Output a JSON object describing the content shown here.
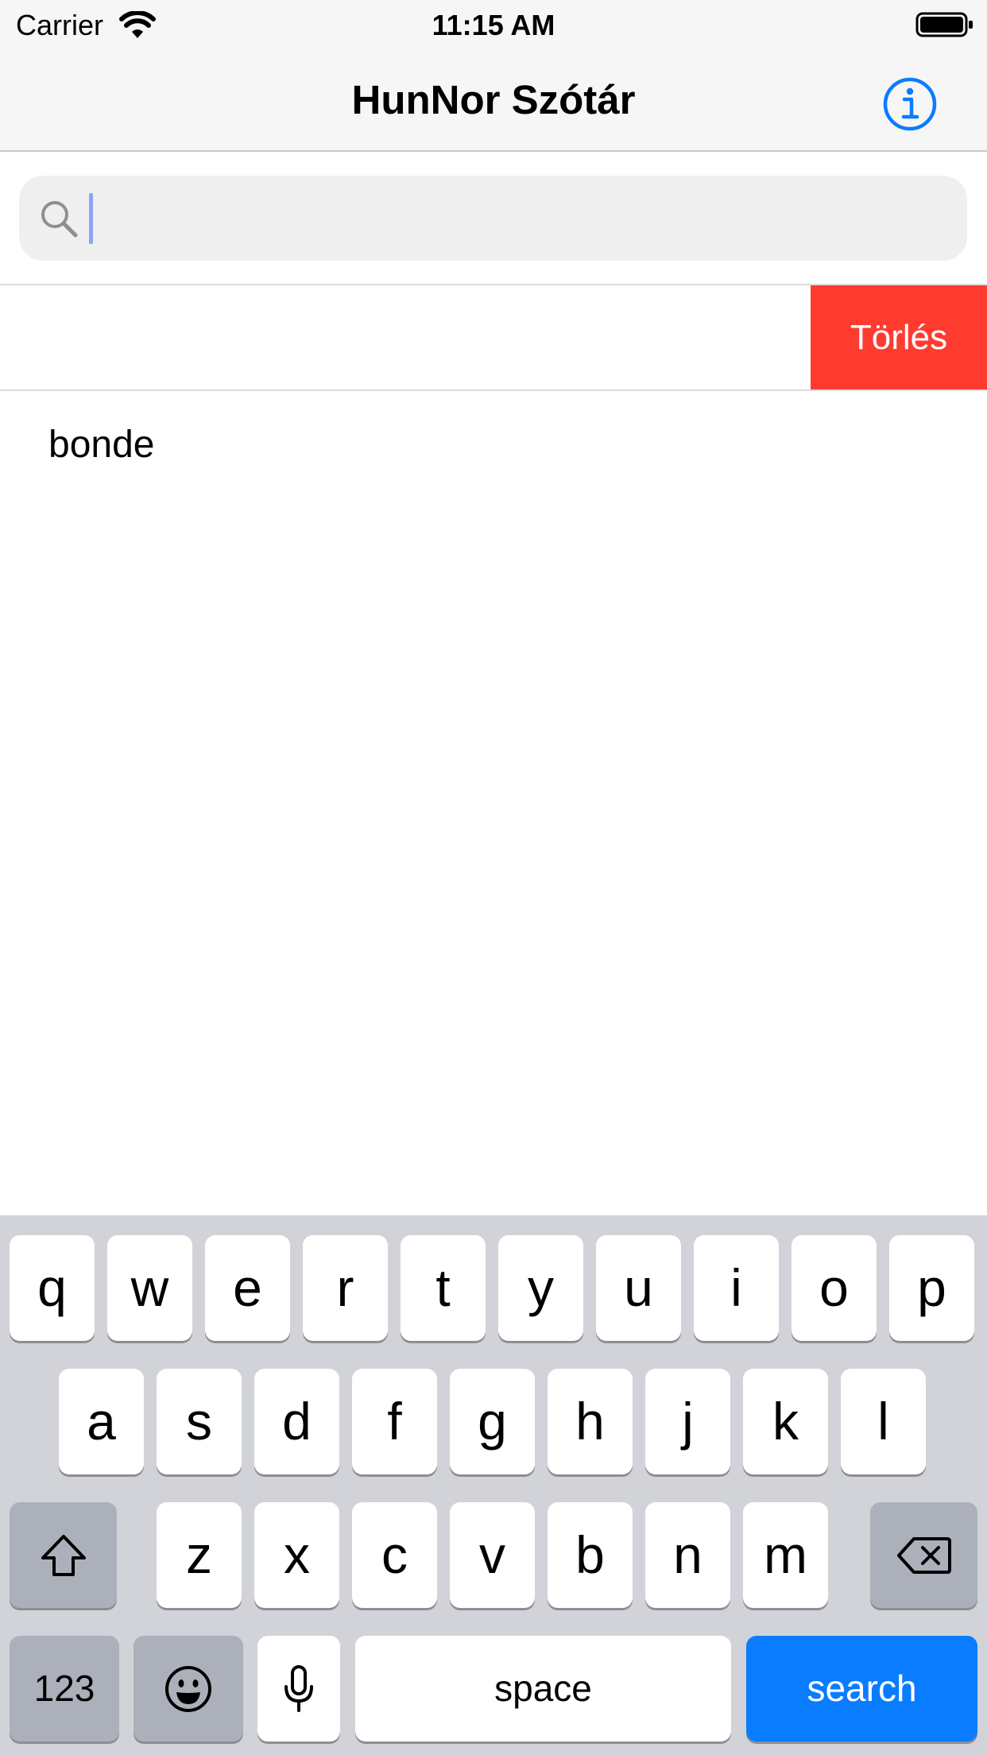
{
  "status_bar": {
    "carrier": "Carrier",
    "time": "11:15 AM"
  },
  "nav": {
    "title": "HunNor Szótár",
    "info_icon": "info-circle-icon"
  },
  "search": {
    "placeholder": "",
    "value": "",
    "icon": "magnifying-glass-icon"
  },
  "list": {
    "swiped_row": {
      "delete_label": "Törlés"
    },
    "rows": [
      {
        "label": "bonde"
      }
    ]
  },
  "keyboard": {
    "row1": [
      "q",
      "w",
      "e",
      "r",
      "t",
      "y",
      "u",
      "i",
      "o",
      "p"
    ],
    "row2": [
      "a",
      "s",
      "d",
      "f",
      "g",
      "h",
      "j",
      "k",
      "l"
    ],
    "row3": [
      "z",
      "x",
      "c",
      "v",
      "b",
      "n",
      "m"
    ],
    "numbers_label": "123",
    "space_label": "space",
    "search_label": "search"
  },
  "colors": {
    "accent": "#0a7cff",
    "delete": "#ff3b30",
    "keyboard_bg": "#d1d3d9"
  }
}
